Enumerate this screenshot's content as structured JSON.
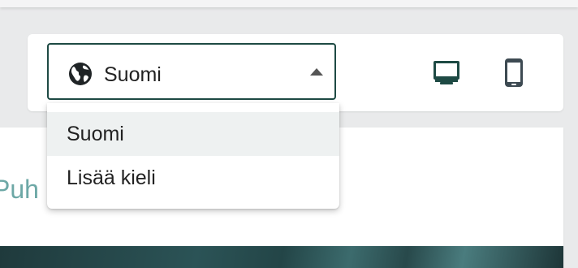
{
  "language_selector": {
    "selected_value": "Suomi",
    "icon": "globe-icon",
    "caret_icon": "caret-up-icon",
    "border_color": "#1e4a44"
  },
  "dropdown": {
    "options": [
      {
        "label": "Suomi",
        "selected": true
      },
      {
        "label": "Lisää kieli",
        "selected": false
      }
    ]
  },
  "preview_toggle": {
    "desktop_icon": "desktop-icon",
    "mobile_icon": "mobile-icon",
    "active_color": "#1e4a44",
    "inactive_color": "#3d4a52"
  },
  "content": {
    "partial_heading": "Puh",
    "heading_color": "#6da8a6"
  }
}
